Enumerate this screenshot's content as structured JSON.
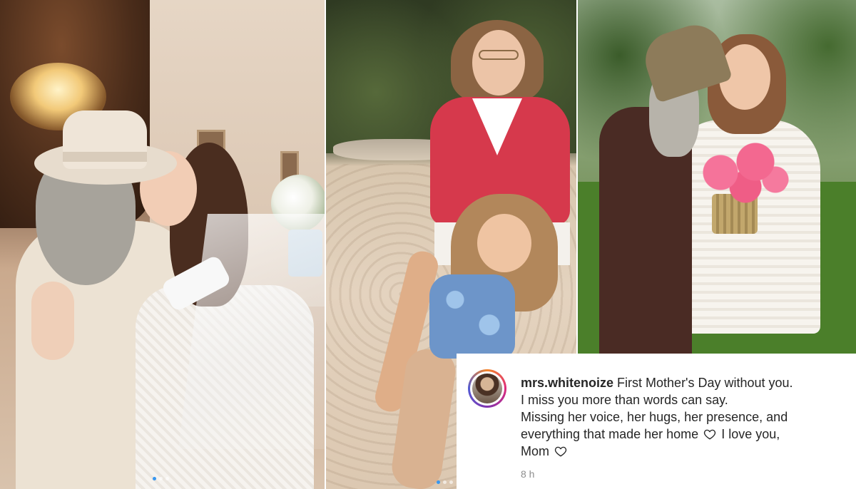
{
  "caption": {
    "username": "mrs.whitenoize",
    "line1": "First Mother's Day without you.",
    "line2": "I miss you more than words can say.",
    "line3": "Missing her voice, her hugs, her presence, and",
    "line4a": "everything that made her home",
    "line4b": "I love you,",
    "line5": "Mom",
    "time": "8 h",
    "icons": [
      "heart-outline-icon",
      "heart-outline-icon"
    ]
  },
  "carousel": {
    "dots_left_count": 3,
    "dots_left_active": 1,
    "dots_middle_count": 3,
    "dots_middle_active": 1
  },
  "colors": {
    "text": "#262626",
    "muted": "#8e8e8e",
    "active_dot": "#3897f0"
  }
}
